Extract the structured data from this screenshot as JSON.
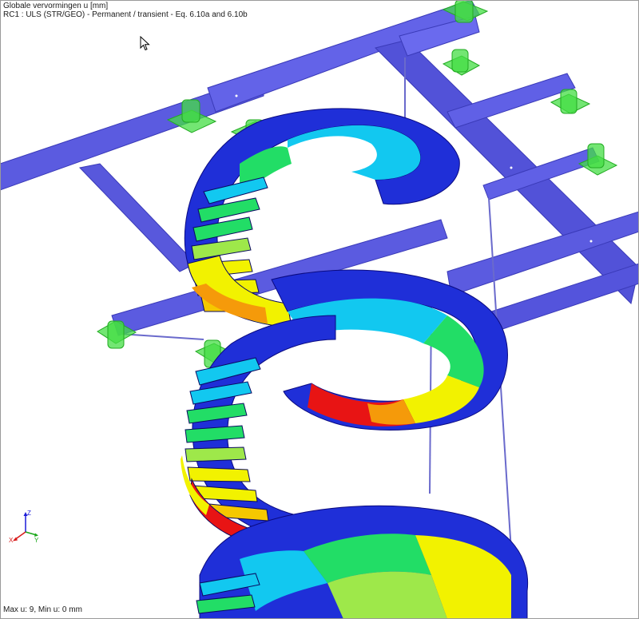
{
  "viewport": {
    "title": "Globale vervormingen u [mm]",
    "combination": "RC1 : ULS (STR/GEO) - Permanent / transient - Eq. 6.10a and 6.10b",
    "minmax": "Max u: 9, Min u: 0 mm"
  },
  "axes": {
    "z": "Z",
    "x": "X",
    "y": "Y"
  },
  "colors": {
    "background": "#ffffff",
    "beam": "#5b5be0",
    "beam_dark": "#3a3ab8",
    "support": "#44dd44",
    "deform_0": "#1f2fd8",
    "deform_1": "#12c8f0",
    "deform_2": "#22dd66",
    "deform_3": "#f2f200",
    "deform_4": "#f59a0a",
    "deform_5": "#e81414"
  }
}
